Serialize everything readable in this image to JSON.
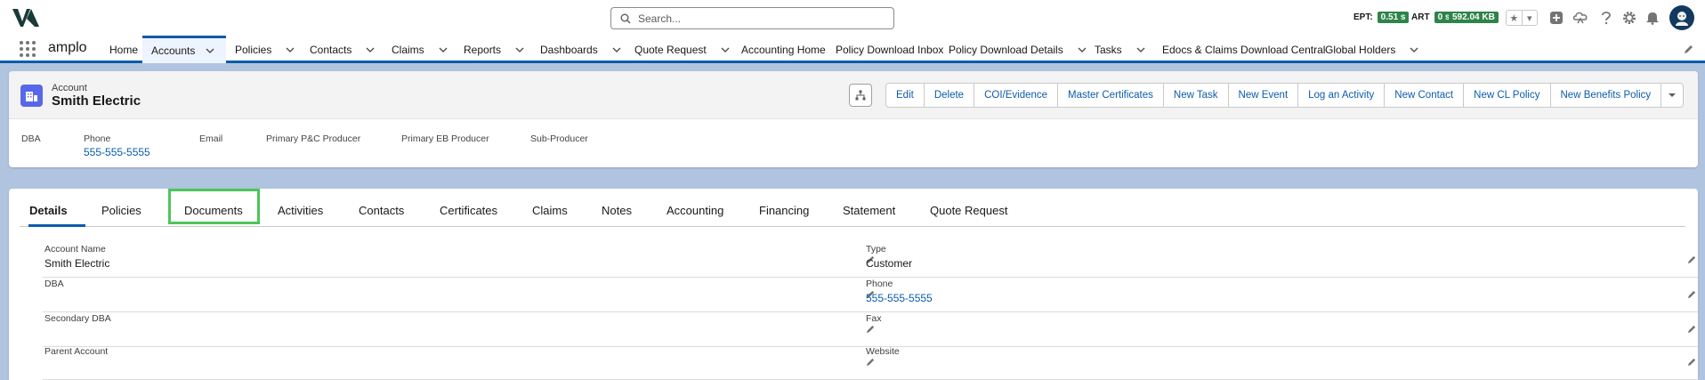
{
  "header": {
    "search_placeholder": "Search...",
    "ept_label": "EPT:",
    "ept_value": "0.51 s",
    "art_label": "ART",
    "art_value": "0 s",
    "memory_value": "592.04 KB",
    "accent_color": "#0b5cab",
    "badge_color": "#2e844a",
    "icons": [
      "add-icon",
      "trailhead-icon",
      "help-icon",
      "settings-icon",
      "bell-icon",
      "avatar"
    ]
  },
  "nav": {
    "app_name": "amplo",
    "items": [
      {
        "label": "Home",
        "has_menu": false
      },
      {
        "label": "Accounts",
        "has_menu": true,
        "active": true
      },
      {
        "label": "Policies",
        "has_menu": true
      },
      {
        "label": "Contacts",
        "has_menu": true
      },
      {
        "label": "Claims",
        "has_menu": true
      },
      {
        "label": "Reports",
        "has_menu": true
      },
      {
        "label": "Dashboards",
        "has_menu": true
      },
      {
        "label": "Quote Request",
        "has_menu": true
      },
      {
        "label": "Accounting Home",
        "has_menu": false
      },
      {
        "label": "Policy Download Inbox",
        "has_menu": false
      },
      {
        "label": "Policy Download Details",
        "has_menu": true
      },
      {
        "label": "Tasks",
        "has_menu": true
      },
      {
        "label": "Edocs & Claims Download Central",
        "has_menu": false
      },
      {
        "label": "Global Holders",
        "has_menu": true
      }
    ]
  },
  "record": {
    "object_label": "Account",
    "title": "Smith Electric",
    "actions": [
      "Edit",
      "Delete",
      "COI/Evidence",
      "Master Certificates",
      "New Task",
      "New Event",
      "Log an Activity",
      "New Contact",
      "New CL Policy",
      "New Benefits Policy"
    ],
    "highlights": {
      "dba_label": "DBA",
      "phone_label": "Phone",
      "phone_value": "555-555-5555",
      "email_label": "Email",
      "pc_producer_label": "Primary P&C Producer",
      "eb_producer_label": "Primary EB Producer",
      "sub_producer_label": "Sub-Producer"
    }
  },
  "tabs": [
    "Details",
    "Policies",
    "Documents",
    "Activities",
    "Contacts",
    "Certificates",
    "Claims",
    "Notes",
    "Accounting",
    "Financing",
    "Statement",
    "Quote Request"
  ],
  "details": {
    "left": [
      {
        "label": "Account Name",
        "value": "Smith Electric"
      },
      {
        "label": "DBA",
        "value": ""
      },
      {
        "label": "Secondary DBA",
        "value": ""
      },
      {
        "label": "Parent Account",
        "value": ""
      }
    ],
    "right": [
      {
        "label": "Type",
        "value": "Customer"
      },
      {
        "label": "Phone",
        "value": "555-555-5555"
      },
      {
        "label": "Fax",
        "value": ""
      },
      {
        "label": "Website",
        "value": ""
      }
    ]
  }
}
